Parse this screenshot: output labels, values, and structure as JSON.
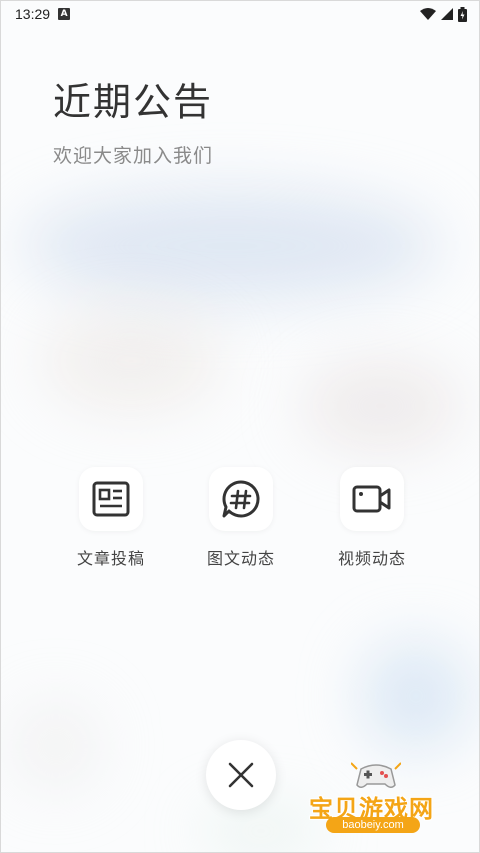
{
  "status_bar": {
    "time": "13:29",
    "notification_badge": "A",
    "icons": [
      "wifi-icon",
      "signal-icon",
      "battery-icon"
    ]
  },
  "header": {
    "title": "近期公告",
    "subtitle": "欢迎大家加入我们"
  },
  "actions": [
    {
      "label": "文章投稿",
      "icon": "article-icon"
    },
    {
      "label": "图文动态",
      "icon": "hashtag-chat-icon"
    },
    {
      "label": "视频动态",
      "icon": "video-camera-icon"
    }
  ],
  "close_button": {
    "icon": "close-icon"
  },
  "watermark": {
    "text": "宝贝游戏网",
    "url": "baobeiy.com"
  },
  "colors": {
    "background": "#fbfcfd",
    "tile": "#ffffff",
    "icon_stroke": "#333333",
    "watermark_accent": "#f4a516"
  }
}
